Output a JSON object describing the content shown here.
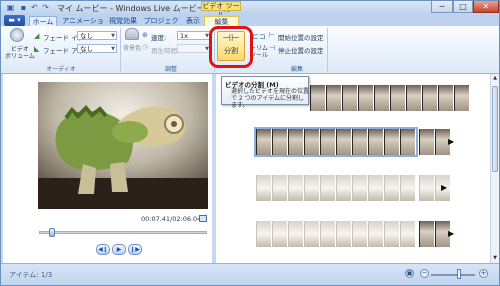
{
  "window": {
    "title": "マイ ムービー - Windows Live ムービー メーカー",
    "tool_tab_title": "ビデオ ツール",
    "buttons": [
      "─",
      "□",
      "✕"
    ]
  },
  "quick_access": [
    "save-icon",
    "undo-icon",
    "redo-icon",
    "dropdown-icon"
  ],
  "tabs": [
    "ホーム",
    "アニメーション",
    "視覚効果",
    "プロジェクト",
    "表示",
    "編集"
  ],
  "ribbon": {
    "video_volume_label": "ビデオ\nボリューム",
    "fade_in_label": "フェード イン:",
    "fade_in_value": "なし",
    "fade_out_label": "フェード アウト:",
    "fade_out_value": "なし",
    "audio_group": "オーディオ",
    "background_color_label": "背景色",
    "speed_label": "速度:",
    "speed_value": "1x",
    "duration_label": "再生時間:",
    "adjust_group": "調整",
    "split_label": "分割",
    "trim_label": "トリム\nツール",
    "set_start_label": "開始位置の設定",
    "set_end_label": "停止位置の設定",
    "edit_group": "編集"
  },
  "tooltip": {
    "title": "ビデオの分割 (M)",
    "body": "選択したビデオを現在の位置で 2 つのアイテムに分割します。"
  },
  "player": {
    "timestamp": "00:07.41/02:06.04",
    "controls": [
      "prev-frame",
      "play",
      "next-frame"
    ],
    "progress_fraction": 0.06
  },
  "status": {
    "text": "アイテム: 1/3"
  },
  "colors": {
    "split_highlight": "#e01212",
    "ribbon_accent": "#2f67b5"
  }
}
